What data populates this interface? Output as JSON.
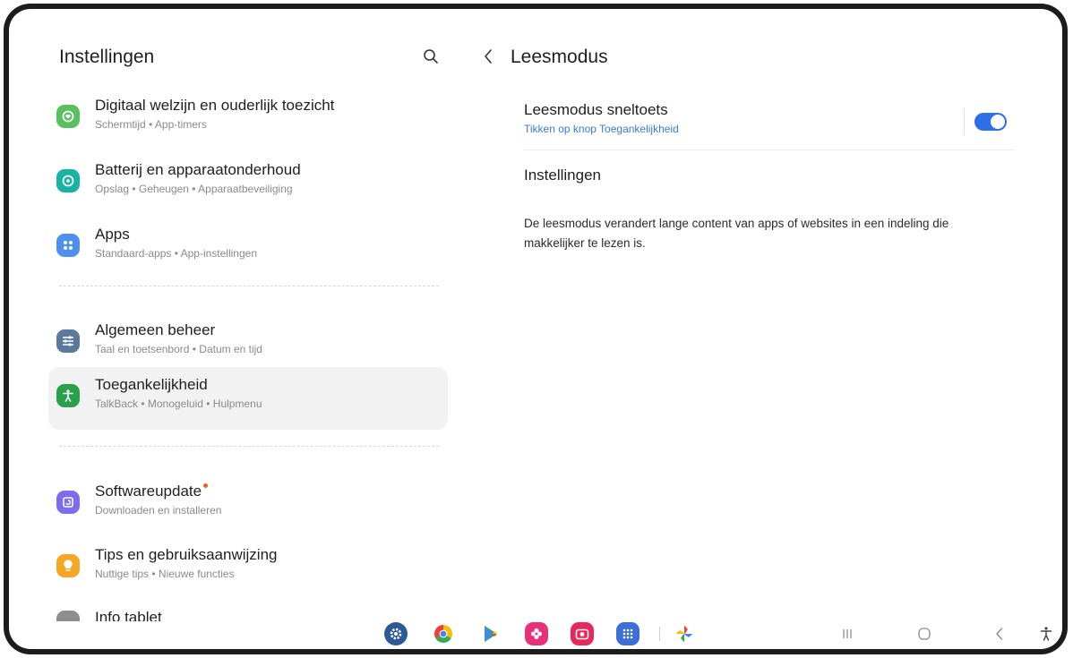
{
  "left_pane": {
    "title": "Instellingen",
    "search_icon": "search-icon",
    "items": [
      {
        "title": "Digitaal welzijn en ouderlijk toezicht",
        "subtitle": "Schermtijd  •  App-timers",
        "icon": "digital-wellbeing-icon",
        "icon_color": "#58c15e"
      },
      {
        "title": "Batterij en apparaatonderhoud",
        "subtitle": "Opslag  •  Geheugen  •  Apparaatbeveiliging",
        "icon": "device-care-icon",
        "icon_color": "#17b3a3"
      },
      {
        "title": "Apps",
        "subtitle": "Standaard-apps  •  App-instellingen",
        "icon": "apps-icon",
        "icon_color": "#4f8ff0"
      },
      {
        "title": "Algemeen beheer",
        "subtitle": "Taal en toetsenbord  •  Datum en tijd",
        "icon": "general-management-icon",
        "icon_color": "#5b7a99"
      },
      {
        "title": "Toegankelijkheid",
        "subtitle": "TalkBack  •  Monogeluid  •  Hulpmenu",
        "icon": "accessibility-icon",
        "icon_color": "#29a14a",
        "selected": true
      },
      {
        "title": "Softwareupdate",
        "subtitle": "Downloaden en installeren",
        "icon": "software-update-icon",
        "icon_color": "#7b6cf0",
        "badge": true
      },
      {
        "title": "Tips en gebruiksaanwijzing",
        "subtitle": "Nuttige tips  •  Nieuwe functies",
        "icon": "tips-icon",
        "icon_color": "#f5a623"
      },
      {
        "title": "Info tablet",
        "icon": "about-tablet-icon",
        "icon_color": "#8d8d8d"
      }
    ]
  },
  "right_pane": {
    "title": "Leesmodus",
    "shortcut": {
      "label": "Leesmodus sneltoets",
      "sublabel": "Tikken op knop Toegankelijkheid",
      "enabled": true
    },
    "settings_label": "Instellingen",
    "description": "De leesmodus verandert lange content van apps of websites in een indeling die makkelijker te lezen is."
  },
  "taskbar": {
    "apps": [
      "settings-app-icon",
      "chrome-app-icon",
      "play-store-app-icon",
      "blossom-app-icon",
      "camera-app-icon",
      "app-drawer-icon",
      "photos-app-icon"
    ],
    "nav": [
      "recent-apps-icon",
      "home-icon",
      "back-icon",
      "accessibility-shortcut-icon"
    ]
  }
}
